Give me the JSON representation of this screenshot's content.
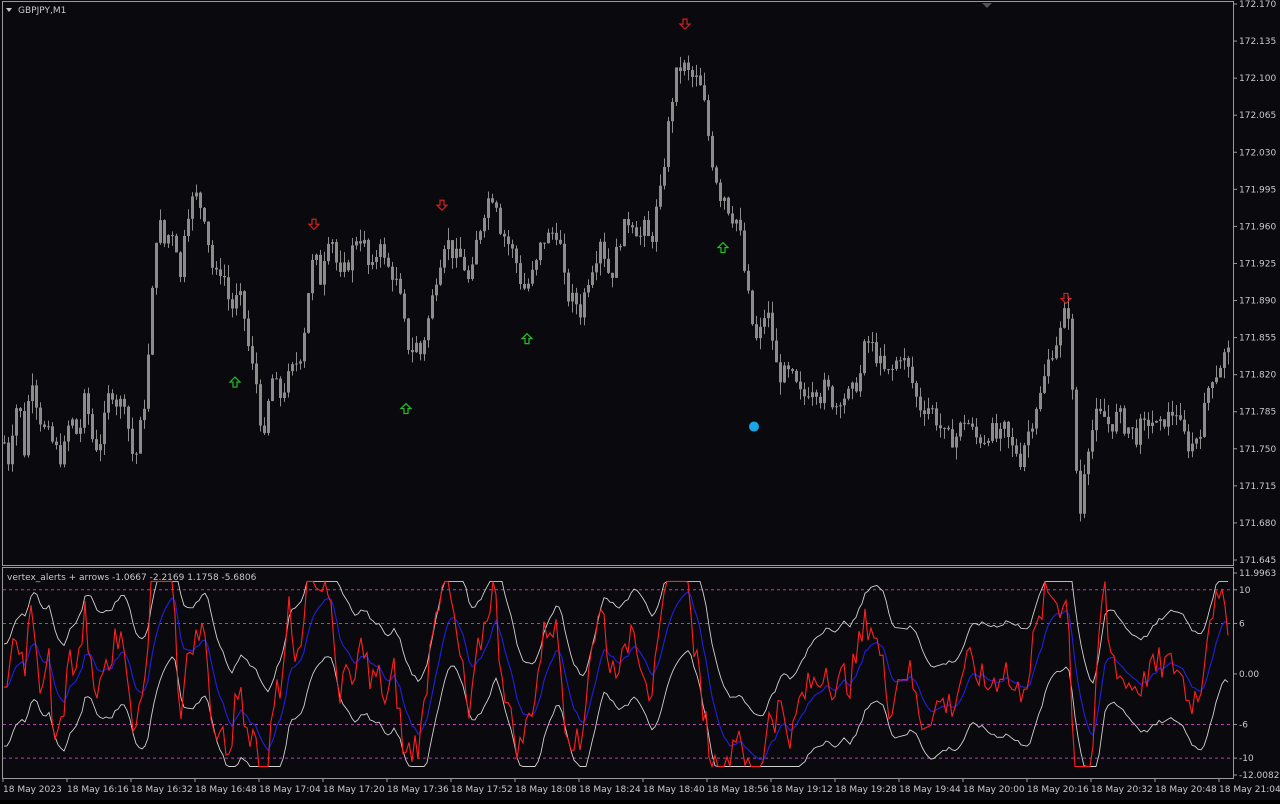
{
  "window": {
    "symbol_label": "GBPJPY,M1"
  },
  "colors": {
    "background": "#0a0a0e",
    "candle": "#8c8c8c",
    "axis_text": "#c8c8c8",
    "grid_line": "#9a9a9a",
    "arrow_up": "#22c022",
    "arrow_down": "#d02020",
    "marker": "#1aa7e8",
    "indicator_fast": "#ff2020",
    "indicator_slow": "#2020e0",
    "indicator_band": "#d0d0d0",
    "level_line": "#b040b0"
  },
  "price_axis": {
    "ticks": [
      "172.170",
      "172.135",
      "172.100",
      "172.065",
      "172.030",
      "171.995",
      "171.960",
      "171.925",
      "171.890",
      "171.855",
      "171.820",
      "171.785",
      "171.750",
      "171.715",
      "171.680",
      "171.645"
    ]
  },
  "time_axis": {
    "ticks": [
      "18 May 2023",
      "18 May 16:16",
      "18 May 16:32",
      "18 May 16:48",
      "18 May 17:04",
      "18 May 17:20",
      "18 May 17:36",
      "18 May 17:52",
      "18 May 18:08",
      "18 May 18:24",
      "18 May 18:40",
      "18 May 18:56",
      "18 May 19:12",
      "18 May 19:28",
      "18 May 19:44",
      "18 May 20:00",
      "18 May 20:16",
      "18 May 20:32",
      "18 May 20:48",
      "18 May 21:04"
    ]
  },
  "indicator": {
    "label": "vertex_alerts + arrows -1.0667 -2.2169 1.1758 -5.6806",
    "axis_ticks": [
      "11.9963",
      "10",
      "6",
      "0.00",
      "-6",
      "-10",
      "-12.0082"
    ],
    "levels": [
      10,
      6,
      -6,
      -10
    ],
    "range": [
      -12.0082,
      11.9963
    ]
  },
  "chart_data": {
    "type": "candlestick",
    "symbol": "GBPJPY",
    "timeframe": "M1",
    "ylim": [
      171.645,
      172.17
    ],
    "price_path": [
      [
        0,
        171.78
      ],
      [
        3,
        171.76
      ],
      [
        8,
        171.74
      ],
      [
        12,
        171.77
      ],
      [
        18,
        171.8
      ],
      [
        25,
        171.74
      ],
      [
        30,
        171.83
      ],
      [
        35,
        171.8
      ],
      [
        42,
        171.77
      ],
      [
        50,
        171.76
      ],
      [
        55,
        171.75
      ],
      [
        62,
        171.74
      ],
      [
        70,
        171.78
      ],
      [
        78,
        171.76
      ],
      [
        85,
        171.8
      ],
      [
        92,
        171.76
      ],
      [
        98,
        171.75
      ],
      [
        105,
        171.78
      ],
      [
        110,
        171.81
      ],
      [
        118,
        171.79
      ],
      [
        125,
        171.8
      ],
      [
        130,
        171.75
      ],
      [
        135,
        171.74
      ],
      [
        140,
        171.77
      ],
      [
        145,
        171.8
      ],
      [
        150,
        171.86
      ],
      [
        155,
        171.95
      ],
      [
        160,
        171.96
      ],
      [
        165,
        171.94
      ],
      [
        170,
        171.96
      ],
      [
        175,
        171.95
      ],
      [
        180,
        171.91
      ],
      [
        185,
        171.97
      ],
      [
        190,
        171.98
      ],
      [
        195,
        171.99
      ],
      [
        200,
        171.98
      ],
      [
        205,
        171.97
      ],
      [
        210,
        171.93
      ],
      [
        215,
        171.91
      ],
      [
        220,
        171.92
      ],
      [
        225,
        171.91
      ],
      [
        230,
        171.88
      ],
      [
        235,
        171.89
      ],
      [
        240,
        171.89
      ],
      [
        245,
        171.87
      ],
      [
        250,
        171.83
      ],
      [
        255,
        171.82
      ],
      [
        260,
        171.78
      ],
      [
        265,
        171.75
      ],
      [
        270,
        171.82
      ],
      [
        275,
        171.81
      ],
      [
        280,
        171.8
      ],
      [
        285,
        171.81
      ],
      [
        290,
        171.82
      ],
      [
        295,
        171.83
      ],
      [
        300,
        171.84
      ],
      [
        305,
        171.87
      ],
      [
        310,
        171.92
      ],
      [
        315,
        171.93
      ],
      [
        320,
        171.91
      ],
      [
        325,
        171.94
      ],
      [
        330,
        171.96
      ],
      [
        335,
        171.93
      ],
      [
        340,
        171.91
      ],
      [
        345,
        171.92
      ],
      [
        350,
        171.93
      ],
      [
        355,
        171.95
      ],
      [
        360,
        171.95
      ],
      [
        365,
        171.94
      ],
      [
        370,
        171.91
      ],
      [
        375,
        171.93
      ],
      [
        380,
        171.95
      ],
      [
        385,
        171.92
      ],
      [
        390,
        171.92
      ],
      [
        395,
        171.91
      ],
      [
        400,
        171.89
      ],
      [
        405,
        171.86
      ],
      [
        410,
        171.84
      ],
      [
        415,
        171.85
      ],
      [
        420,
        171.84
      ],
      [
        425,
        171.86
      ],
      [
        430,
        171.88
      ],
      [
        435,
        171.91
      ],
      [
        440,
        171.93
      ],
      [
        445,
        171.95
      ],
      [
        450,
        171.94
      ],
      [
        455,
        171.93
      ],
      [
        460,
        171.93
      ],
      [
        465,
        171.92
      ],
      [
        470,
        171.9
      ],
      [
        475,
        171.94
      ],
      [
        480,
        171.96
      ],
      [
        485,
        171.98
      ],
      [
        490,
        171.99
      ],
      [
        495,
        171.99
      ],
      [
        500,
        171.96
      ],
      [
        505,
        171.95
      ],
      [
        510,
        171.94
      ],
      [
        515,
        171.93
      ],
      [
        520,
        171.91
      ],
      [
        525,
        171.9
      ],
      [
        530,
        171.91
      ],
      [
        535,
        171.92
      ],
      [
        540,
        171.94
      ],
      [
        545,
        171.95
      ],
      [
        550,
        171.95
      ],
      [
        555,
        171.96
      ],
      [
        560,
        171.94
      ],
      [
        565,
        171.9
      ],
      [
        570,
        171.89
      ],
      [
        575,
        171.89
      ],
      [
        580,
        171.88
      ],
      [
        585,
        171.9
      ],
      [
        590,
        171.92
      ],
      [
        595,
        171.93
      ],
      [
        600,
        171.95
      ],
      [
        605,
        171.93
      ],
      [
        610,
        171.91
      ],
      [
        615,
        171.93
      ],
      [
        620,
        171.95
      ],
      [
        625,
        171.96
      ],
      [
        630,
        171.97
      ],
      [
        635,
        171.96
      ],
      [
        640,
        171.95
      ],
      [
        645,
        171.96
      ],
      [
        650,
        171.94
      ],
      [
        655,
        171.97
      ],
      [
        660,
        171.99
      ],
      [
        665,
        172.03
      ],
      [
        670,
        172.07
      ],
      [
        675,
        172.1
      ],
      [
        680,
        172.11
      ],
      [
        685,
        172.11
      ],
      [
        690,
        172.1
      ],
      [
        695,
        172.1
      ],
      [
        700,
        172.09
      ],
      [
        705,
        172.07
      ],
      [
        710,
        172.03
      ],
      [
        715,
        172.01
      ],
      [
        720,
        171.99
      ],
      [
        725,
        171.99
      ],
      [
        730,
        171.97
      ],
      [
        735,
        171.97
      ],
      [
        740,
        171.95
      ],
      [
        745,
        171.91
      ],
      [
        750,
        171.88
      ],
      [
        755,
        171.85
      ],
      [
        760,
        171.86
      ],
      [
        765,
        171.88
      ],
      [
        770,
        171.87
      ],
      [
        775,
        171.83
      ],
      [
        780,
        171.82
      ],
      [
        785,
        171.82
      ],
      [
        790,
        171.82
      ],
      [
        795,
        171.81
      ],
      [
        800,
        171.8
      ],
      [
        805,
        171.8
      ],
      [
        810,
        171.81
      ],
      [
        815,
        171.81
      ],
      [
        820,
        171.8
      ],
      [
        825,
        171.81
      ],
      [
        830,
        171.8
      ],
      [
        835,
        171.79
      ],
      [
        840,
        171.8
      ],
      [
        845,
        171.8
      ],
      [
        850,
        171.8
      ],
      [
        855,
        171.81
      ],
      [
        860,
        171.82
      ],
      [
        865,
        171.85
      ],
      [
        870,
        171.85
      ],
      [
        875,
        171.84
      ],
      [
        880,
        171.83
      ],
      [
        885,
        171.82
      ],
      [
        890,
        171.82
      ],
      [
        895,
        171.83
      ],
      [
        900,
        171.84
      ],
      [
        905,
        171.83
      ],
      [
        910,
        171.82
      ],
      [
        915,
        171.8
      ],
      [
        920,
        171.79
      ],
      [
        925,
        171.79
      ],
      [
        930,
        171.79
      ],
      [
        935,
        171.78
      ],
      [
        940,
        171.77
      ],
      [
        945,
        171.76
      ],
      [
        950,
        171.76
      ],
      [
        955,
        171.76
      ],
      [
        960,
        171.77
      ],
      [
        965,
        171.78
      ],
      [
        970,
        171.77
      ],
      [
        975,
        171.76
      ],
      [
        980,
        171.76
      ],
      [
        985,
        171.76
      ],
      [
        990,
        171.77
      ],
      [
        995,
        171.76
      ],
      [
        1000,
        171.76
      ],
      [
        1005,
        171.77
      ],
      [
        1010,
        171.75
      ],
      [
        1015,
        171.75
      ],
      [
        1020,
        171.74
      ],
      [
        1025,
        171.76
      ],
      [
        1030,
        171.77
      ],
      [
        1035,
        171.79
      ],
      [
        1040,
        171.8
      ],
      [
        1045,
        171.82
      ],
      [
        1050,
        171.84
      ],
      [
        1055,
        171.85
      ],
      [
        1060,
        171.86
      ],
      [
        1065,
        171.88
      ],
      [
        1068,
        171.88
      ],
      [
        1072,
        171.8
      ],
      [
        1075,
        171.74
      ],
      [
        1078,
        171.71
      ],
      [
        1081,
        171.68
      ],
      [
        1085,
        171.75
      ],
      [
        1090,
        171.76
      ],
      [
        1095,
        171.78
      ],
      [
        1100,
        171.78
      ],
      [
        1105,
        171.78
      ],
      [
        1110,
        171.77
      ],
      [
        1115,
        171.78
      ],
      [
        1120,
        171.78
      ],
      [
        1125,
        171.77
      ],
      [
        1130,
        171.77
      ],
      [
        1135,
        171.76
      ],
      [
        1140,
        171.77
      ],
      [
        1145,
        171.77
      ],
      [
        1150,
        171.78
      ],
      [
        1155,
        171.77
      ],
      [
        1160,
        171.77
      ],
      [
        1165,
        171.78
      ],
      [
        1170,
        171.78
      ],
      [
        1175,
        171.79
      ],
      [
        1180,
        171.77
      ],
      [
        1185,
        171.76
      ],
      [
        1190,
        171.75
      ],
      [
        1195,
        171.76
      ],
      [
        1200,
        171.77
      ],
      [
        1205,
        171.79
      ],
      [
        1210,
        171.82
      ],
      [
        1215,
        171.82
      ],
      [
        1220,
        171.83
      ],
      [
        1225,
        171.84
      ],
      [
        1230,
        171.84
      ]
    ],
    "signals": [
      {
        "dir": "up",
        "time_index": 235,
        "price": 171.813
      },
      {
        "dir": "up",
        "time_index": 406,
        "price": 171.788
      },
      {
        "dir": "up",
        "time_index": 527,
        "price": 171.854
      },
      {
        "dir": "up",
        "time_index": 723,
        "price": 171.94
      },
      {
        "dir": "down",
        "time_index": 314,
        "price": 171.962
      },
      {
        "dir": "down",
        "time_index": 442,
        "price": 171.98
      },
      {
        "dir": "down",
        "time_index": 685,
        "price": 172.151
      },
      {
        "dir": "down",
        "time_index": 1066,
        "price": 171.892
      }
    ],
    "marker": {
      "time_index": 754,
      "price": 171.771
    }
  }
}
